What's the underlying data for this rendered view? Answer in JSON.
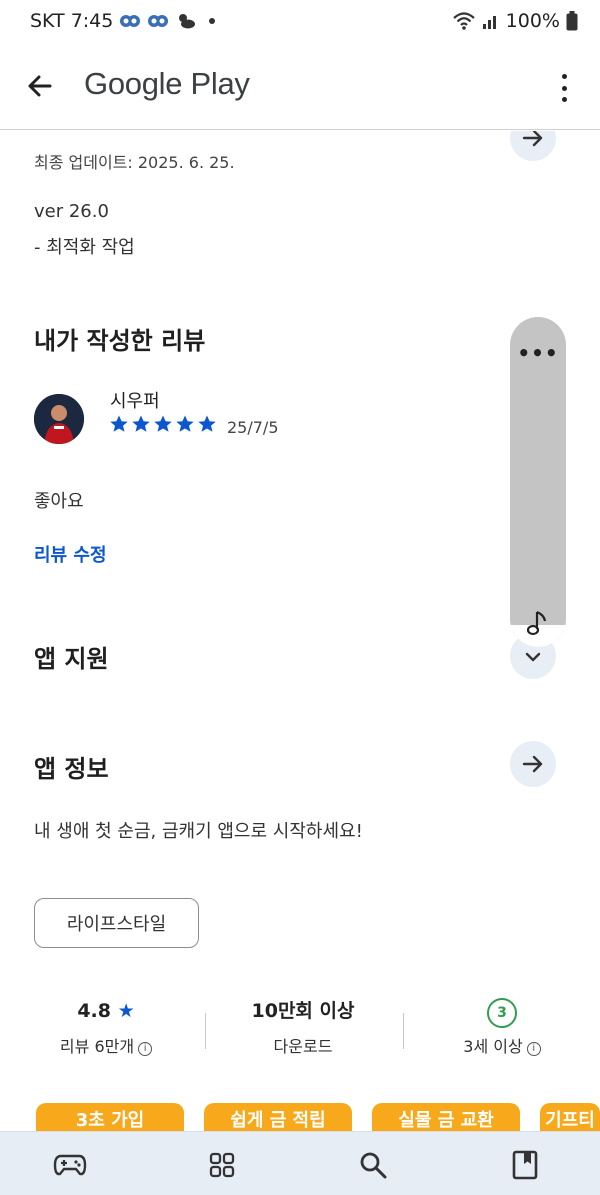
{
  "status_bar": {
    "carrier_time": "SKT 7:45",
    "battery": "100%"
  },
  "app_bar": {
    "title": "Google Play",
    "back_icon": "arrow-left-icon",
    "more_icon": "more-vert-icon"
  },
  "whats_new": {
    "updated": "최종 업데이트: 2025. 6. 25.",
    "version": "ver 26.0",
    "changes": "- 최적화 작업"
  },
  "my_review": {
    "title": "내가 작성한 리뷰",
    "reviewer": "시우퍼",
    "rating": 5,
    "date": "25/7/5",
    "text": "좋아요",
    "edit_label": "리뷰 수정"
  },
  "app_support": {
    "title": "앱 지원"
  },
  "app_info": {
    "title": "앱 정보",
    "description": "내 생애 첫 순금, 금캐기 앱으로 시작하세요!",
    "category": "라이프스타일"
  },
  "stats": {
    "rating_value": "4.8",
    "rating_label": "리뷰 6만개",
    "downloads_value": "10만회 이상",
    "downloads_label": "다운로드",
    "age_badge": "3",
    "age_label": "3세 이상"
  },
  "promos": [
    "3초 가입",
    "쉽게 금 적립",
    "실물 금 교환",
    "기프티"
  ],
  "colors": {
    "accent_blue": "#0b57d0",
    "star_blue": "#0b57d0",
    "age_green": "#2e9e4f",
    "promo_orange": "#f7a81b",
    "nav_bg": "#e7edf5"
  },
  "bottom_nav": {
    "icons": [
      "gamepad-icon",
      "apps-icon",
      "search-icon",
      "bookmark-icon"
    ]
  }
}
